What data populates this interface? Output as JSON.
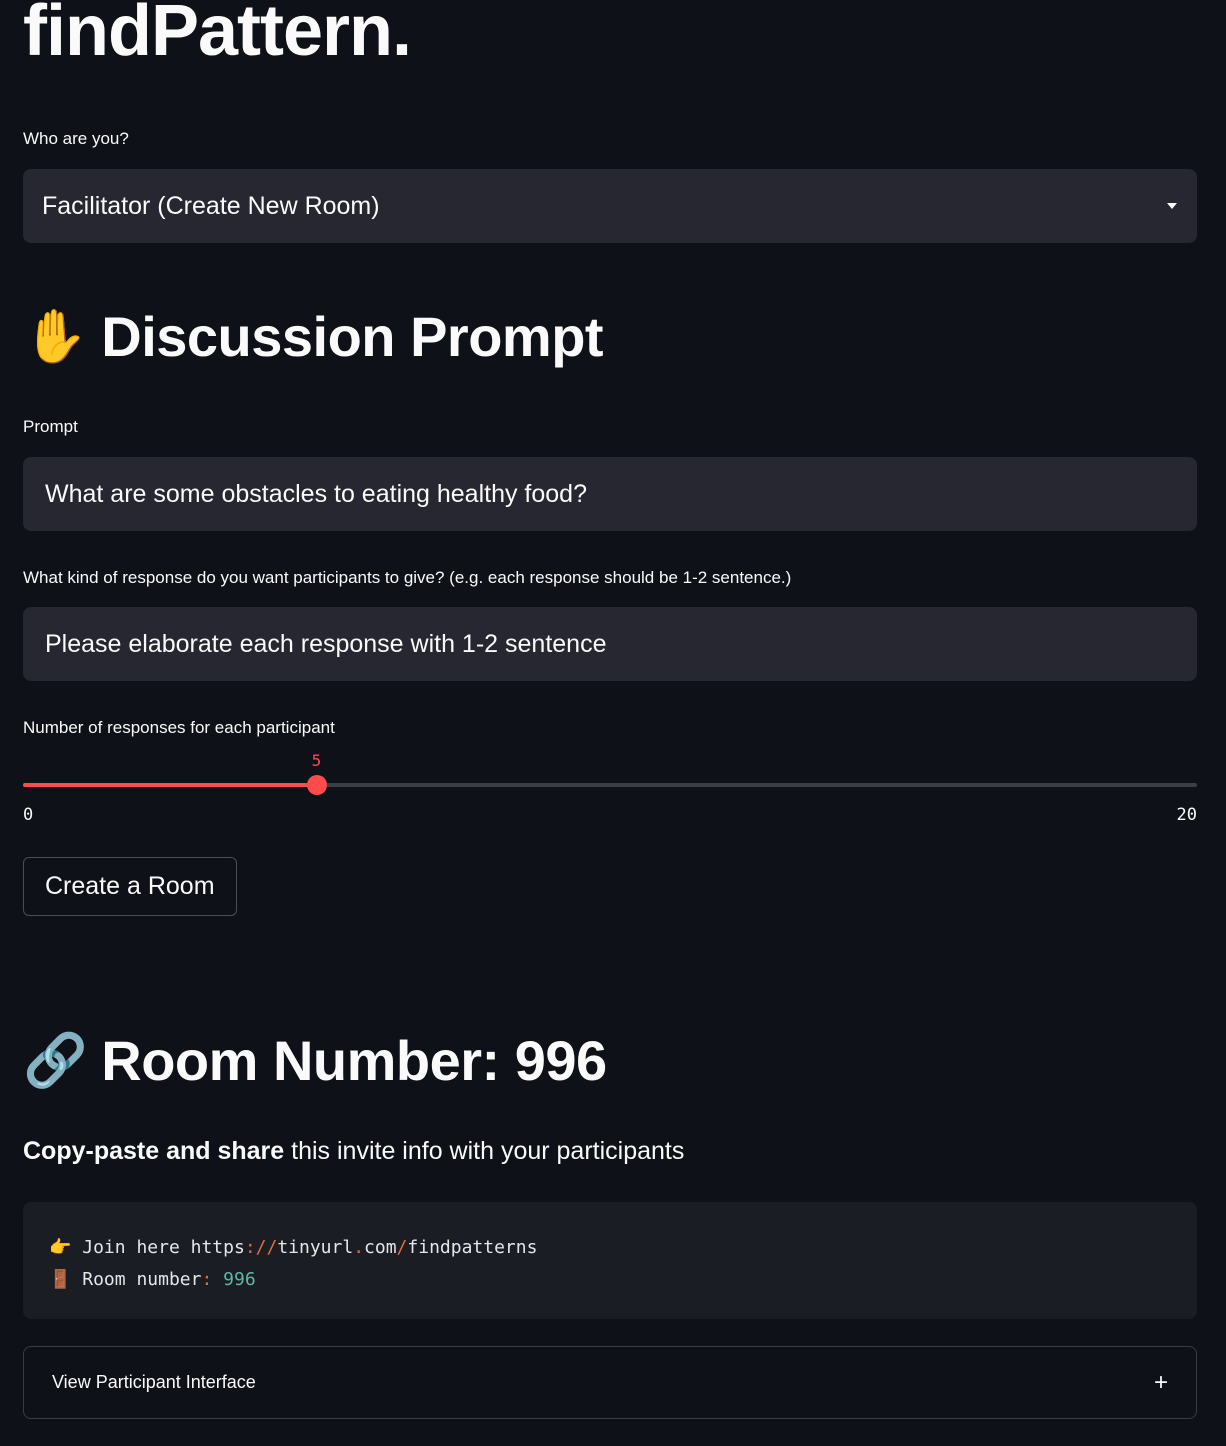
{
  "app": {
    "title": "findPattern."
  },
  "role": {
    "label": "Who are you?",
    "selected": "Facilitator (Create New Room)"
  },
  "prompt_section": {
    "emoji": "✋",
    "heading": "Discussion Prompt",
    "prompt_label": "Prompt",
    "prompt_value": "What are some obstacles to eating healthy food?",
    "response_label": "What kind of response do you want participants to give? (e.g. each response should be 1-2 sentence.)",
    "response_value": "Please elaborate each response with 1-2 sentence",
    "slider": {
      "label": "Number of responses for each participant",
      "min": 0,
      "max": 20,
      "value": 5,
      "min_label": "0",
      "max_label": "20",
      "value_label": "5"
    },
    "create_button": "Create a Room"
  },
  "room": {
    "emoji": "🔗",
    "heading": "Room Number: 996",
    "invite_bold": "Copy-paste and share",
    "invite_rest": " this invite info with your participants",
    "code": {
      "line1_emoji": "👉",
      "line1_text": " Join here https",
      "line1_sep1": "://",
      "line1_host": "tinyurl",
      "line1_dot": ".",
      "line1_domain": "com",
      "line1_slash": "/",
      "line1_path": "findpatterns",
      "line2_emoji": "🚪",
      "line2_text": " Room number",
      "line2_colon": ": ",
      "line2_value": "996"
    },
    "expander_label": "View Participant Interface"
  },
  "colors": {
    "background": "#0e1117",
    "input_bg": "#262730",
    "accent": "#ff4b4b"
  }
}
